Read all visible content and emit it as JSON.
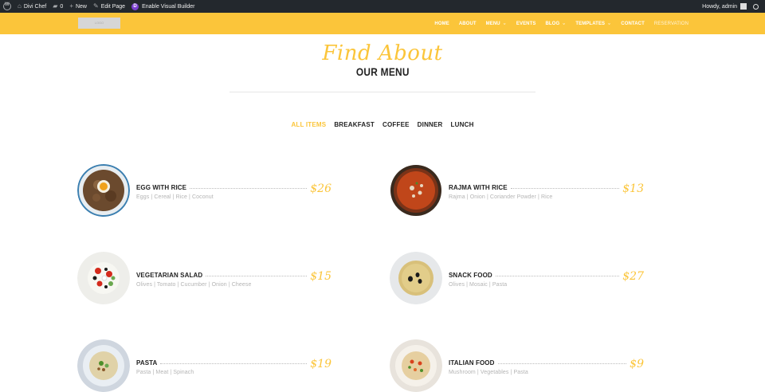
{
  "adminbar": {
    "site_name": "Divi Chef",
    "comments_count": "0",
    "new_label": "New",
    "edit_label": "Edit Page",
    "visual_builder_label": "Enable Visual Builder",
    "howdy": "Howdy, admin"
  },
  "header": {
    "logo_text": "LOGO",
    "nav": [
      {
        "label": "HOME"
      },
      {
        "label": "ABOUT"
      },
      {
        "label": "MENU"
      },
      {
        "label": "EVENTS"
      },
      {
        "label": "BLOG"
      },
      {
        "label": "TEMPLATES"
      },
      {
        "label": "CONTACT"
      },
      {
        "label": "RESERVATION"
      }
    ]
  },
  "title": {
    "script": "Find About",
    "main": "OUR MENU"
  },
  "tabs": [
    "ALL ITEMS",
    "BREAKFAST",
    "COFFEE",
    "DINNER",
    "LUNCH"
  ],
  "items": [
    {
      "name": "EGG WITH RICE",
      "desc": "Eggs | Cereal | Rice | Coconut",
      "price": "$26"
    },
    {
      "name": "RAJMA WITH RICE",
      "desc": "Rajma | Onion | Coriander Powder | Rice",
      "price": "$13"
    },
    {
      "name": "VEGETARIAN SALAD",
      "desc": "Olives | Tomato | Cucumber | Onion | Cheese",
      "price": "$15"
    },
    {
      "name": "SNACK FOOD",
      "desc": "Olives | Mosaic | Pasta",
      "price": "$27"
    },
    {
      "name": "PASTA",
      "desc": "Pasta | Meat | Spinach",
      "price": "$19"
    },
    {
      "name": "ITALIAN FOOD",
      "desc": "Mushroom | Vegetables | Pasta",
      "price": "$9"
    }
  ],
  "colors": {
    "accent": "#fbc53a",
    "admin_bar": "#23282d",
    "text_dark": "#222222",
    "text_muted": "#b4b4b4"
  }
}
